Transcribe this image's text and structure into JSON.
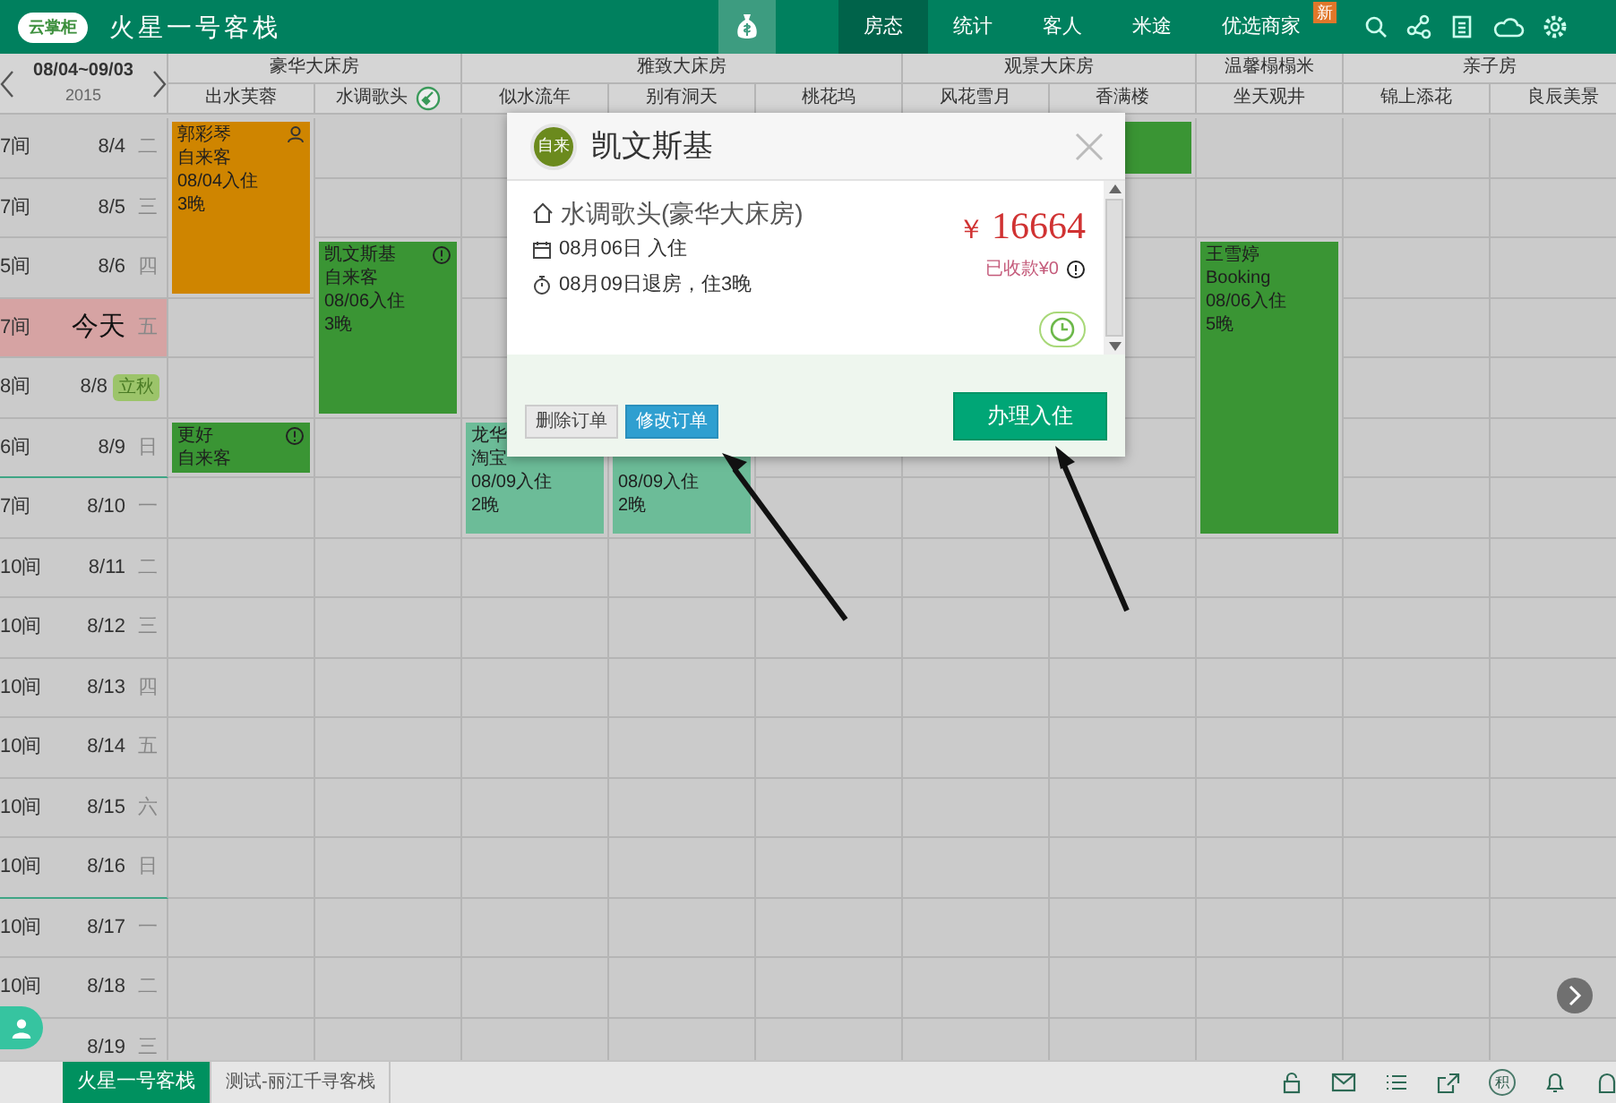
{
  "app": {
    "logo": "云掌柜",
    "title": "火星一号客栈"
  },
  "nav": [
    {
      "label": "房态",
      "selected": true
    },
    {
      "label": "统计",
      "selected": false
    },
    {
      "label": "客人",
      "selected": false
    },
    {
      "label": "米途",
      "selected": false
    },
    {
      "label": "优选商家",
      "selected": false,
      "badge": "新"
    }
  ],
  "date_range": {
    "range": "08/04~09/03",
    "year": "2015"
  },
  "room_types": [
    {
      "name": "豪华大床房",
      "rooms": [
        {
          "name": "出水芙蓉",
          "cleaning": false
        },
        {
          "name": "水调歌头",
          "cleaning": true
        }
      ]
    },
    {
      "name": "雅致大床房",
      "rooms": [
        {
          "name": "似水流年",
          "cleaning": false
        },
        {
          "name": "别有洞天",
          "cleaning": false
        },
        {
          "name": "桃花坞",
          "cleaning": false
        }
      ]
    },
    {
      "name": "观景大床房",
      "rooms": [
        {
          "name": "风花雪月",
          "cleaning": false
        },
        {
          "name": "香满楼",
          "cleaning": false
        }
      ]
    },
    {
      "name": "温馨榻榻米",
      "rooms": [
        {
          "name": "坐天观井",
          "cleaning": false
        }
      ]
    },
    {
      "name": "亲子房",
      "rooms": [
        {
          "name": "锦上添花",
          "cleaning": false
        },
        {
          "name": "良辰美景",
          "cleaning": false
        }
      ]
    }
  ],
  "days": [
    {
      "count": "7间",
      "date": "8/4",
      "weekday": "二",
      "today": false,
      "week_end": false,
      "cells": [
        {
          "kind": "start_member",
          "guest": "郭彩琴",
          "source": "自来客",
          "checkin": "08/04入住",
          "nights": "3晚",
          "color": "#cf8500"
        },
        {
          "kind": "free"
        },
        {
          "kind": "free"
        },
        {
          "kind": "covered"
        },
        {
          "kind": "covered"
        },
        {
          "kind": "covered"
        },
        {
          "kind": "start",
          "color": "#3a9534"
        },
        {
          "kind": "free"
        },
        {
          "kind": "free"
        },
        {
          "kind": "free"
        }
      ]
    },
    {
      "count": "7间",
      "date": "8/5",
      "weekday": "三",
      "today": false,
      "week_end": false,
      "cells": [
        {
          "kind": "booked"
        },
        {
          "kind": "free"
        },
        {
          "kind": "free"
        },
        {
          "kind": "covered"
        },
        {
          "kind": "covered"
        },
        {
          "kind": "covered"
        },
        {
          "kind": "free"
        },
        {
          "kind": "free"
        },
        {
          "kind": "free"
        },
        {
          "kind": "free"
        }
      ]
    },
    {
      "count": "5间",
      "date": "8/6",
      "weekday": "四",
      "today": false,
      "week_end": false,
      "cells": [
        {
          "kind": "booked"
        },
        {
          "kind": "start_notice",
          "guest": "凯文斯基",
          "source": "自来客",
          "checkin": "08/06入住",
          "nights": "3晚",
          "color": "#3a9534"
        },
        {
          "kind": "free"
        },
        {
          "kind": "covered"
        },
        {
          "kind": "covered"
        },
        {
          "kind": "covered"
        },
        {
          "kind": "free"
        },
        {
          "kind": "start",
          "guest": "王雪婷",
          "source": "Booking",
          "checkin": "08/06入住",
          "nights": "5晚",
          "color": "#3a9534"
        },
        {
          "kind": "free"
        },
        {
          "kind": "free"
        }
      ]
    },
    {
      "count": "7间",
      "date": "今天",
      "weekday": "五",
      "today": true,
      "week_end": false,
      "cells": [
        {
          "kind": "free"
        },
        {
          "kind": "booked"
        },
        {
          "kind": "free"
        },
        {
          "kind": "covered"
        },
        {
          "kind": "covered"
        },
        {
          "kind": "covered"
        },
        {
          "kind": "free"
        },
        {
          "kind": "booked"
        },
        {
          "kind": "free"
        },
        {
          "kind": "free"
        }
      ]
    },
    {
      "count": "8间",
      "date": "8/8",
      "festival": "立秋",
      "today": false,
      "week_end": false,
      "cells": [
        {
          "kind": "free"
        },
        {
          "kind": "booked"
        },
        {
          "kind": "free"
        },
        {
          "kind": "covered"
        },
        {
          "kind": "covered"
        },
        {
          "kind": "covered"
        },
        {
          "kind": "free"
        },
        {
          "kind": "booked"
        },
        {
          "kind": "free"
        },
        {
          "kind": "free"
        }
      ]
    },
    {
      "count": "6间",
      "date": "8/9",
      "weekday": "日",
      "today": false,
      "week_end": true,
      "cells": [
        {
          "kind": "start_notice",
          "guest": "更好",
          "source": "自来客",
          "color": "#3a9534"
        },
        {
          "kind": "free"
        },
        {
          "kind": "start",
          "guest": "龙华",
          "source": "淘宝",
          "checkin": "08/09入住",
          "nights": "2晚",
          "color": "#6cbc98"
        },
        {
          "kind": "start",
          "checkin": "08/09入住",
          "nights": "2晚",
          "color": "#6cbc98"
        },
        {
          "kind": "free"
        },
        {
          "kind": "free"
        },
        {
          "kind": "free"
        },
        {
          "kind": "booked"
        },
        {
          "kind": "free"
        },
        {
          "kind": "free"
        }
      ]
    },
    {
      "count": "7间",
      "date": "8/10",
      "weekday": "一",
      "today": false,
      "week_end": false,
      "cells": [
        {
          "kind": "free"
        },
        {
          "kind": "free"
        },
        {
          "kind": "booked"
        },
        {
          "kind": "booked"
        },
        {
          "kind": "free"
        },
        {
          "kind": "free"
        },
        {
          "kind": "free"
        },
        {
          "kind": "booked"
        },
        {
          "kind": "free"
        },
        {
          "kind": "free"
        }
      ]
    },
    {
      "count": "10间",
      "date": "8/11",
      "weekday": "二",
      "today": false,
      "week_end": false,
      "cells": [
        {
          "kind": "free"
        },
        {
          "kind": "free"
        },
        {
          "kind": "free"
        },
        {
          "kind": "free"
        },
        {
          "kind": "free"
        },
        {
          "kind": "free"
        },
        {
          "kind": "free"
        },
        {
          "kind": "free"
        },
        {
          "kind": "free"
        },
        {
          "kind": "free"
        }
      ]
    },
    {
      "count": "10间",
      "date": "8/12",
      "weekday": "三",
      "today": false,
      "week_end": false,
      "cells": [
        {
          "kind": "free"
        },
        {
          "kind": "free"
        },
        {
          "kind": "free"
        },
        {
          "kind": "free"
        },
        {
          "kind": "free"
        },
        {
          "kind": "free"
        },
        {
          "kind": "free"
        },
        {
          "kind": "free"
        },
        {
          "kind": "free"
        },
        {
          "kind": "free"
        }
      ]
    },
    {
      "count": "10间",
      "date": "8/13",
      "weekday": "四",
      "today": false,
      "week_end": false,
      "cells": [
        {
          "kind": "free"
        },
        {
          "kind": "free"
        },
        {
          "kind": "free"
        },
        {
          "kind": "free"
        },
        {
          "kind": "free"
        },
        {
          "kind": "free"
        },
        {
          "kind": "free"
        },
        {
          "kind": "free"
        },
        {
          "kind": "free"
        },
        {
          "kind": "free"
        }
      ]
    },
    {
      "count": "10间",
      "date": "8/14",
      "weekday": "五",
      "today": false,
      "week_end": false,
      "cells": [
        {
          "kind": "free"
        },
        {
          "kind": "free"
        },
        {
          "kind": "free"
        },
        {
          "kind": "free"
        },
        {
          "kind": "free"
        },
        {
          "kind": "free"
        },
        {
          "kind": "free"
        },
        {
          "kind": "free"
        },
        {
          "kind": "free"
        },
        {
          "kind": "free"
        }
      ]
    },
    {
      "count": "10间",
      "date": "8/15",
      "weekday": "六",
      "today": false,
      "week_end": false,
      "cells": [
        {
          "kind": "free"
        },
        {
          "kind": "free"
        },
        {
          "kind": "free"
        },
        {
          "kind": "free"
        },
        {
          "kind": "free"
        },
        {
          "kind": "free"
        },
        {
          "kind": "free"
        },
        {
          "kind": "free"
        },
        {
          "kind": "free"
        },
        {
          "kind": "free"
        }
      ]
    },
    {
      "count": "10间",
      "date": "8/16",
      "weekday": "日",
      "today": false,
      "week_end": true,
      "cells": [
        {
          "kind": "free"
        },
        {
          "kind": "free"
        },
        {
          "kind": "free"
        },
        {
          "kind": "free"
        },
        {
          "kind": "free"
        },
        {
          "kind": "free"
        },
        {
          "kind": "free"
        },
        {
          "kind": "free"
        },
        {
          "kind": "free"
        },
        {
          "kind": "free"
        }
      ]
    },
    {
      "count": "10间",
      "date": "8/17",
      "weekday": "一",
      "today": false,
      "week_end": false,
      "cells": [
        {
          "kind": "free"
        },
        {
          "kind": "free"
        },
        {
          "kind": "free"
        },
        {
          "kind": "free"
        },
        {
          "kind": "free"
        },
        {
          "kind": "free"
        },
        {
          "kind": "free"
        },
        {
          "kind": "free"
        },
        {
          "kind": "free"
        },
        {
          "kind": "free"
        }
      ]
    },
    {
      "count": "10间",
      "date": "8/18",
      "weekday": "二",
      "today": false,
      "week_end": false,
      "cells": [
        {
          "kind": "free"
        },
        {
          "kind": "free"
        },
        {
          "kind": "free"
        },
        {
          "kind": "free"
        },
        {
          "kind": "free"
        },
        {
          "kind": "free"
        },
        {
          "kind": "free"
        },
        {
          "kind": "free"
        },
        {
          "kind": "free"
        },
        {
          "kind": "free"
        }
      ]
    },
    {
      "date": "8/19",
      "weekday": "三",
      "today": false,
      "week_end": false,
      "cells": [
        {
          "kind": "free"
        },
        {
          "kind": "free"
        },
        {
          "kind": "free"
        },
        {
          "kind": "free"
        },
        {
          "kind": "free"
        },
        {
          "kind": "free"
        },
        {
          "kind": "free"
        },
        {
          "kind": "free"
        },
        {
          "kind": "free"
        },
        {
          "kind": "free"
        }
      ]
    }
  ],
  "order_popup": {
    "source_badge": "自来",
    "guest": "凯文斯基",
    "room": "水调歌头(豪华大床房)",
    "checkin": "08月06日 入住",
    "checkout": "08月09日退房，住3晚",
    "currency": "￥",
    "amount": "16664",
    "paid": "已收款¥0",
    "buttons": [
      {
        "label": "删除订单",
        "kind": "secondary"
      },
      {
        "label": "修改订单",
        "kind": "info"
      },
      {
        "label": "办理入住",
        "kind": "primary"
      }
    ]
  },
  "hotel_tabs": [
    {
      "label": "火星一号客栈",
      "selected": true
    },
    {
      "label": "测试-丽江千寻客栈",
      "selected": false
    }
  ],
  "points_label": "积"
}
